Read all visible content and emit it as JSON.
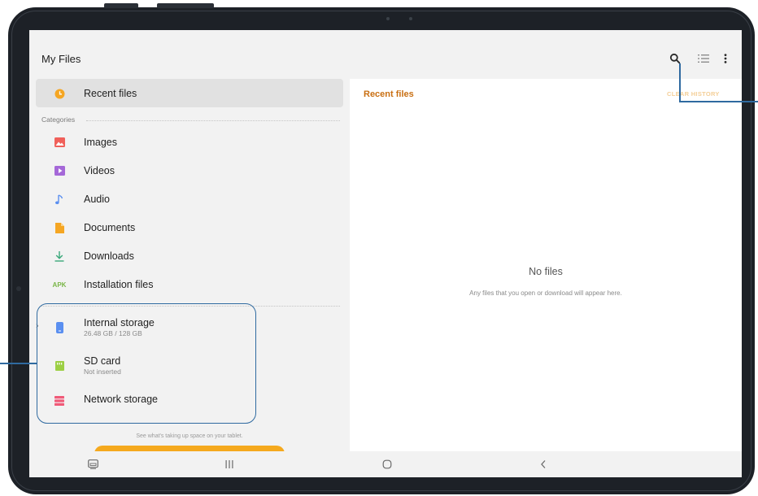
{
  "app": {
    "title": "My Files",
    "icons": [
      "search-icon",
      "list-view-icon",
      "more-options-icon"
    ]
  },
  "sidebar": {
    "recent": {
      "label": "Recent files",
      "icon": "clock-icon",
      "color": "#f5a623"
    },
    "categories_label": "Categories",
    "categories": [
      {
        "label": "Images",
        "icon": "image-icon",
        "color": "#f0605a"
      },
      {
        "label": "Videos",
        "icon": "video-icon",
        "color": "#a568d8"
      },
      {
        "label": "Audio",
        "icon": "music-icon",
        "color": "#5a8ff0"
      },
      {
        "label": "Documents",
        "icon": "document-icon",
        "color": "#f5a623"
      },
      {
        "label": "Downloads",
        "icon": "download-icon",
        "color": "#3aa87a"
      },
      {
        "label": "Installation files",
        "icon": "apk-icon",
        "icon_text": "APK",
        "color": "#7ab648"
      }
    ],
    "storage": [
      {
        "label": "Internal storage",
        "sub": "26.48 GB / 128 GB",
        "icon": "phone-storage-icon",
        "color": "#5a8ff0"
      },
      {
        "label": "SD card",
        "sub": "Not inserted",
        "icon": "sd-card-icon",
        "color": "#9ccf44"
      },
      {
        "label": "Network storage",
        "icon": "server-icon",
        "color": "#f05a78"
      }
    ],
    "storage_note": "See what's taking up space on your tablet."
  },
  "main": {
    "title": "Recent files",
    "clear_history": "CLEAR HISTORY",
    "empty_title": "No files",
    "empty_subtitle": "Any files that you open or download will appear here."
  },
  "navbar": {
    "buttons": [
      "screenshot-icon",
      "recent-apps-icon",
      "home-icon",
      "back-icon"
    ]
  },
  "colors": {
    "accent": "#f5a91e",
    "title_accent": "#c96f12",
    "callout": "#2f6aa0"
  }
}
